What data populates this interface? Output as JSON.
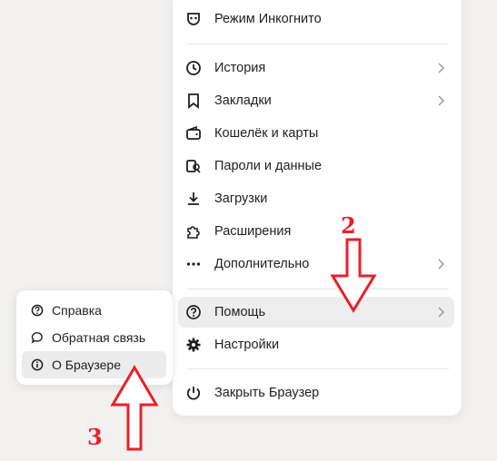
{
  "menu": {
    "incognito": "Режим Инкогнито",
    "history": "История",
    "bookmarks": "Закладки",
    "wallet": "Кошелёк и карты",
    "passwords": "Пароли и данные",
    "downloads": "Загрузки",
    "extensions": "Расширения",
    "more": "Дополнительно",
    "help": "Помощь",
    "settings": "Настройки",
    "close": "Закрыть Браузер"
  },
  "submenu": {
    "help_center": "Справка",
    "feedback": "Обратная связь",
    "about": "О Браузере"
  },
  "annotations": {
    "step2": "2",
    "step3": "3",
    "arrow_color": "#e8202a"
  },
  "colors": {
    "background": "#f2f1f0",
    "menu_bg": "#ffffff",
    "hover_bg": "#ededed"
  }
}
